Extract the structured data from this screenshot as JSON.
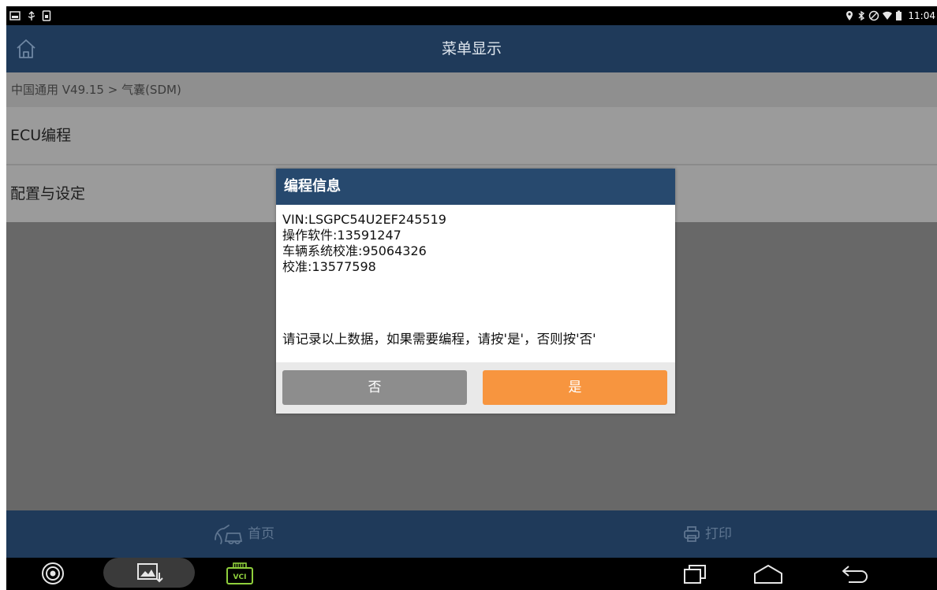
{
  "status_bar": {
    "time": "11:04"
  },
  "header": {
    "title": "菜单显示"
  },
  "breadcrumb": "中国通用 V49.15 > 气囊(SDM)",
  "menu": {
    "items": [
      "ECU编程",
      "配置与设定"
    ]
  },
  "dialog": {
    "title": "编程信息",
    "lines": [
      "VIN:LSGPC54U2EF245519",
      "操作软件:13591247",
      "车辆系统校准:95064326",
      "校准:13577598"
    ],
    "note": "请记录以上数据，如果需要编程，请按'是'，否则按'否'",
    "no_label": "否",
    "yes_label": "是"
  },
  "toolbar": {
    "home_label": "首页",
    "print_label": "打印"
  },
  "nav": {
    "vci_label": "VCI"
  },
  "colors": {
    "header_bg": "#1f3a5a",
    "dialog_header_bg": "#27496e",
    "yes_button": "#f7953f",
    "no_button": "#8d8d8d"
  }
}
